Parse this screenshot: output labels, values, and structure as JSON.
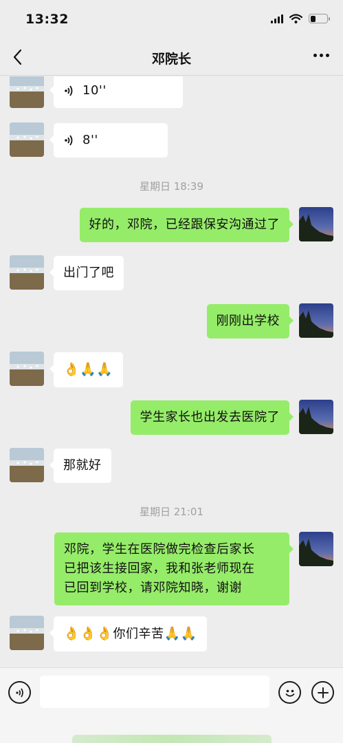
{
  "status_bar": {
    "time": "13:32",
    "signal_icon": "cellular-signal-icon",
    "wifi_icon": "wifi-icon",
    "battery_icon": "battery-icon",
    "battery_level": 0.3
  },
  "nav": {
    "back_icon": "chevron-left-icon",
    "title": "邓院长",
    "more_icon": "more-dots-icon"
  },
  "messages": [
    {
      "type": "voice",
      "side": "left",
      "duration": "10''"
    },
    {
      "type": "voice",
      "side": "left",
      "duration": "8''"
    },
    {
      "type": "time",
      "text": "星期日 18:39"
    },
    {
      "type": "text",
      "side": "right",
      "text": "好的，邓院，已经跟保安沟通过了"
    },
    {
      "type": "text",
      "side": "left",
      "text": "出门了吧"
    },
    {
      "type": "text",
      "side": "right",
      "text": "刚刚出学校"
    },
    {
      "type": "emoji",
      "side": "left",
      "emojis": [
        "ok-hand-emoji",
        "folded-hands-emoji",
        "folded-hands-emoji"
      ]
    },
    {
      "type": "text",
      "side": "right",
      "text": "学生家长也出发去医院了"
    },
    {
      "type": "text",
      "side": "left",
      "text": "那就好"
    },
    {
      "type": "time",
      "text": "星期日 21:01"
    },
    {
      "type": "text",
      "side": "right",
      "lines": [
        "邓院，学生在医院做完检查后家长",
        "已把该生接回家，我和张老师现在",
        "已回到学校，请邓院知晓，谢谢"
      ]
    },
    {
      "type": "mixed",
      "side": "left",
      "text": "你们辛苦",
      "emojis_before": [
        "ok-hand-emoji",
        "ok-hand-emoji",
        "ok-hand-emoji"
      ],
      "emojis_after": [
        "folded-hands-emoji",
        "folded-hands-emoji"
      ]
    }
  ],
  "input_bar": {
    "voice_button_icon": "voice-input-icon",
    "emoji_button_icon": "smiley-icon",
    "plus_button_icon": "plus-icon",
    "text_value": ""
  },
  "colors": {
    "background": "#ededed",
    "sent_bubble": "#95ec69",
    "received_bubble": "#ffffff",
    "time_label": "#a0a0a0"
  }
}
